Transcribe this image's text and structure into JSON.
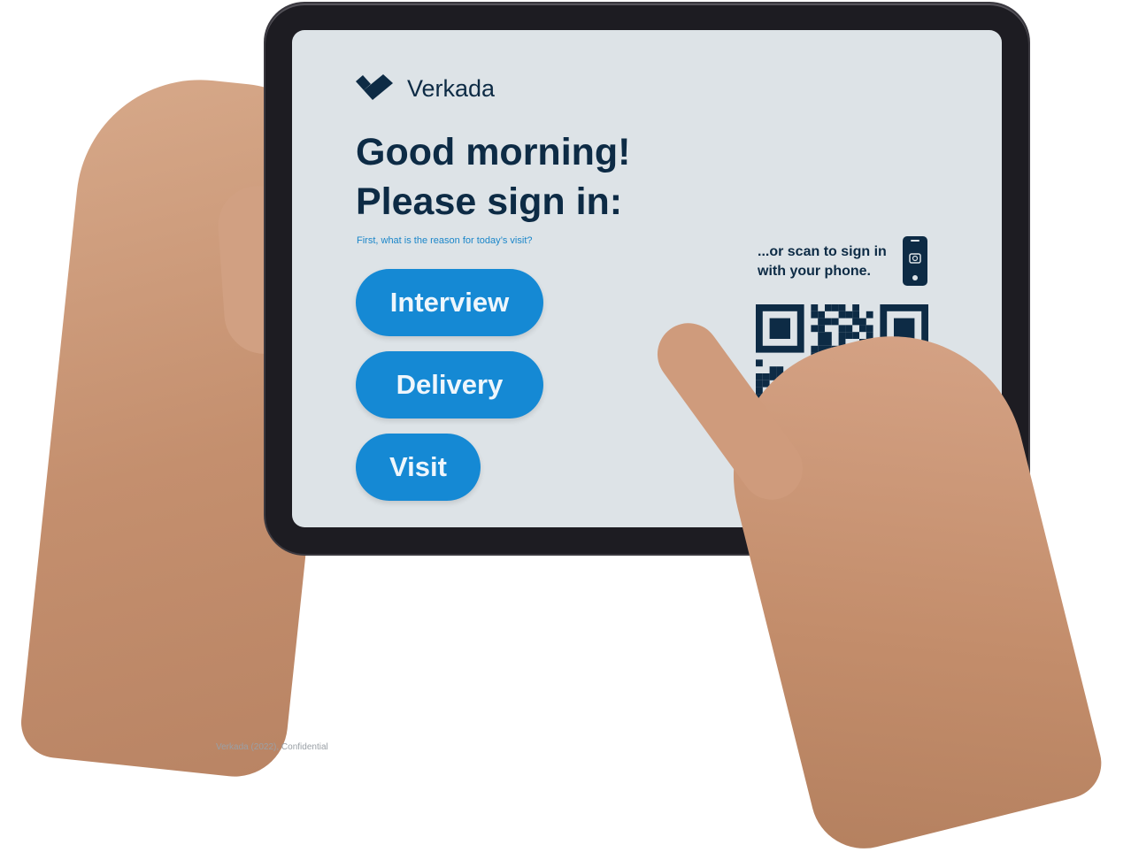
{
  "brand": {
    "logo_icon": "verkada-check-logo-icon",
    "name": "Verkada"
  },
  "greeting": {
    "line1": "Good morning!",
    "line2": "Please sign in:"
  },
  "prompt": "First, what is the reason for today’s visit?",
  "reasons": [
    {
      "label": "Interview"
    },
    {
      "label": "Delivery"
    },
    {
      "label": "Visit"
    }
  ],
  "scan": {
    "text_line1": "...or scan to sign in",
    "text_line2": "with your phone.",
    "phone_icon": "phone-camera-icon",
    "qr_icon": "qr-code-icon"
  },
  "footer": "Verkada (2022), Confidential",
  "colors": {
    "accent": "#1589d4",
    "navy": "#0d2b45",
    "screen_bg": "#dde3e7",
    "prompt_text": "#1b86c9"
  }
}
